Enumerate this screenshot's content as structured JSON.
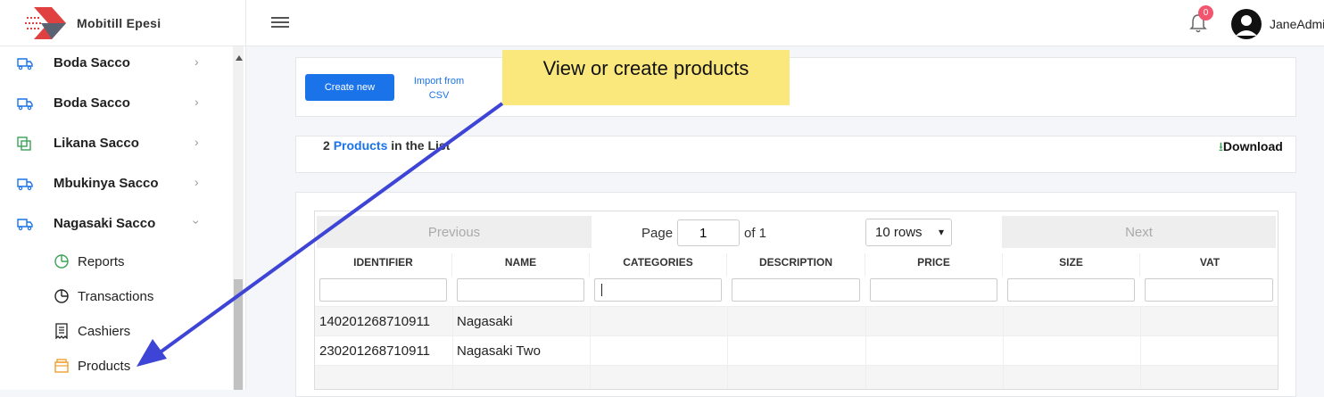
{
  "app": {
    "name": "Mobitill Epesi"
  },
  "header": {
    "notification_count": "0",
    "username": "JaneAdmin"
  },
  "sidebar": {
    "items": [
      {
        "label": "Boda Sacco",
        "icon": "truck-icon",
        "color": "#1a73e8"
      },
      {
        "label": "Boda Sacco",
        "icon": "truck-icon",
        "color": "#1a73e8"
      },
      {
        "label": "Likana Sacco",
        "icon": "copy-icon",
        "color": "#3aa357"
      },
      {
        "label": "Mbukinya Sacco",
        "icon": "truck-icon",
        "color": "#1a73e8"
      },
      {
        "label": "Nagasaki Sacco",
        "icon": "truck-icon",
        "color": "#1a73e8",
        "expanded": true
      }
    ],
    "subitems": [
      {
        "label": "Reports",
        "icon": "pie-chart-icon",
        "color": "#3aa357"
      },
      {
        "label": "Transactions",
        "icon": "pie-chart-icon",
        "color": "#222222"
      },
      {
        "label": "Cashiers",
        "icon": "receipt-icon",
        "color": "#222222"
      },
      {
        "label": "Products",
        "icon": "box-icon",
        "color": "#f0a030"
      }
    ]
  },
  "actions": {
    "create_label": "Create new",
    "import_label": "Import from CSV"
  },
  "tooltip": {
    "text": "View or create products"
  },
  "summary": {
    "count": "2",
    "products_word": "Products",
    "suffix": "in the List",
    "download_label": "Download"
  },
  "pagination": {
    "previous": "Previous",
    "page_label": "Page",
    "page_value": "1",
    "of_label": "of 1",
    "rows_option": "10 rows",
    "next": "Next"
  },
  "table": {
    "columns": [
      "IDENTIFIER",
      "NAME",
      "CATEGORIES",
      "DESCRIPTION",
      "PRICE",
      "SIZE",
      "VAT"
    ],
    "rows": [
      {
        "identifier": "140201268710911",
        "name": "Nagasaki"
      },
      {
        "identifier": "230201268710911",
        "name": "Nagasaki Two"
      }
    ]
  }
}
